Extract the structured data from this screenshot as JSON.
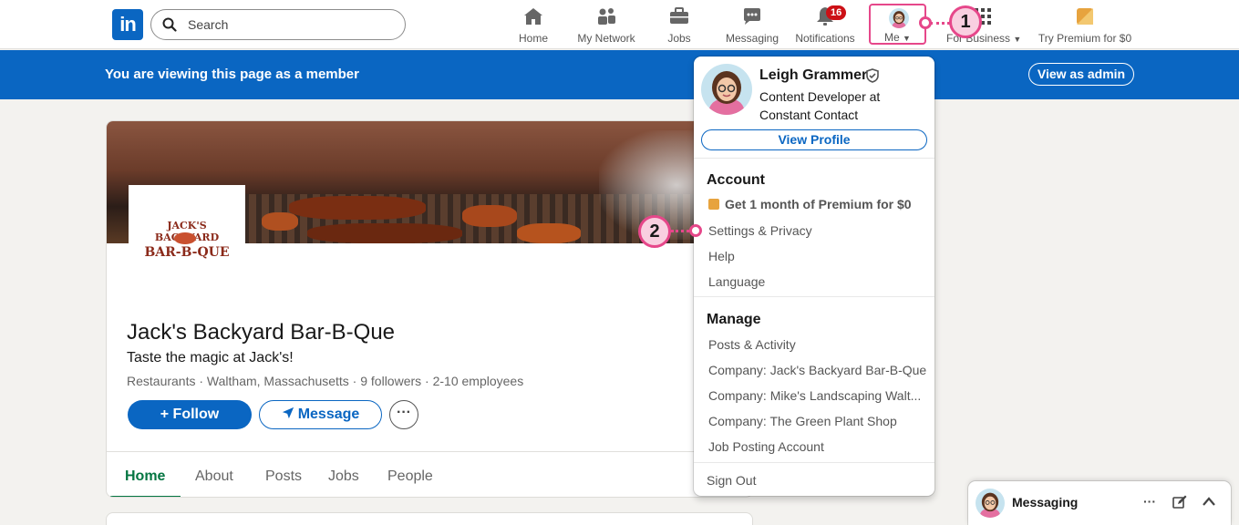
{
  "nav": {
    "logo": "in",
    "search_placeholder": "Search",
    "items": [
      {
        "label": "Home"
      },
      {
        "label": "My Network"
      },
      {
        "label": "Jobs"
      },
      {
        "label": "Messaging"
      },
      {
        "label": "Notifications",
        "badge": "16"
      }
    ],
    "me_label": "Me",
    "for_business_label": "For Business",
    "premium_label": "Try Premium for $0"
  },
  "callouts": {
    "one": "1",
    "two": "2"
  },
  "member_bar": {
    "text": "You are viewing this page as a member",
    "admin_button": "View as admin"
  },
  "company": {
    "logo_line1": "JACK'S BACKYARD",
    "logo_line2": "BAR-B-QUE",
    "name": "Jack's Backyard Bar-B-Que",
    "tagline": "Taste the magic at Jack's!",
    "meta_location": "Restaurants · Waltham, Massachusetts · 9 followers",
    "meta_employees": "2-10 employees",
    "follow_button": "+ Follow",
    "message_button": "Message",
    "more_button": "···",
    "tabs": [
      {
        "label": "Home"
      },
      {
        "label": "About"
      },
      {
        "label": "Posts"
      },
      {
        "label": "Jobs"
      },
      {
        "label": "People"
      }
    ]
  },
  "dropdown": {
    "name": "Leigh Grammer",
    "headline": "Content Developer at Constant Contact",
    "view_profile": "View Profile",
    "account_heading": "Account",
    "premium_item": "Get 1 month of Premium for $0",
    "account_items": [
      "Settings & Privacy",
      "Help",
      "Language"
    ],
    "manage_heading": "Manage",
    "manage_items": [
      "Posts & Activity",
      "Company: Jack's Backyard Bar-B-Que",
      "Company: Mike's Landscaping Walt...",
      "Company: The Green Plant Shop",
      "Job Posting Account"
    ],
    "sign_out": "Sign Out"
  },
  "messaging": {
    "label": "Messaging",
    "more": "···"
  },
  "colors": {
    "brand_blue": "#0a66c2",
    "callout_pink": "#e6478a",
    "active_tab_green": "#057642",
    "notification_red": "#cc1016"
  }
}
